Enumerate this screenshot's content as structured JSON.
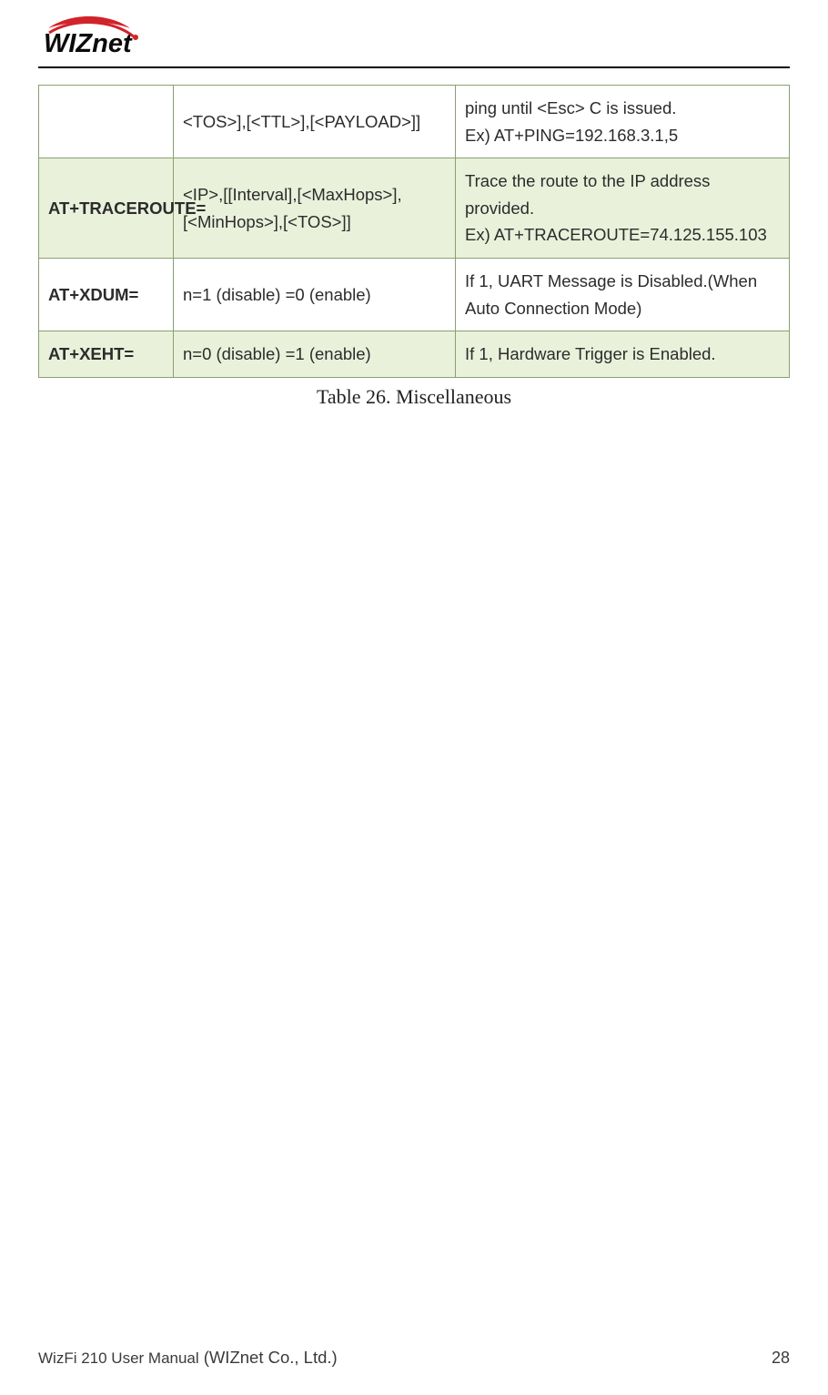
{
  "logo_text": "WIZnet",
  "table": {
    "rows": [
      {
        "cmd": "",
        "param": "<TOS>],[<TTL>],[<PAYLOAD>]]",
        "desc": "ping until <Esc> C is issued.\nEx) AT+PING=192.168.3.1,5",
        "alt": false
      },
      {
        "cmd": "AT+TRACEROUTE=",
        "param": "<IP>,[[Interval],[<MaxHops>],[<MinHops>],[<TOS>]]",
        "desc": "Trace the route to the IP address provided.\nEx) AT+TRACEROUTE=74.125.155.103",
        "alt": true
      },
      {
        "cmd": "AT+XDUM=",
        "param": "n=1 (disable) =0 (enable)",
        "desc": "If 1, UART Message is Disabled.(When Auto Connection Mode)",
        "alt": false
      },
      {
        "cmd": "AT+XEHT=",
        "param": "n=0 (disable) =1 (enable)",
        "desc": "If 1, Hardware Trigger is Enabled.",
        "alt": true
      }
    ]
  },
  "caption": "Table 26. Miscellaneous",
  "footer": {
    "manual": "WizFi 210 User Manual",
    "company": "(WIZnet Co., Ltd.)",
    "page": "28"
  }
}
